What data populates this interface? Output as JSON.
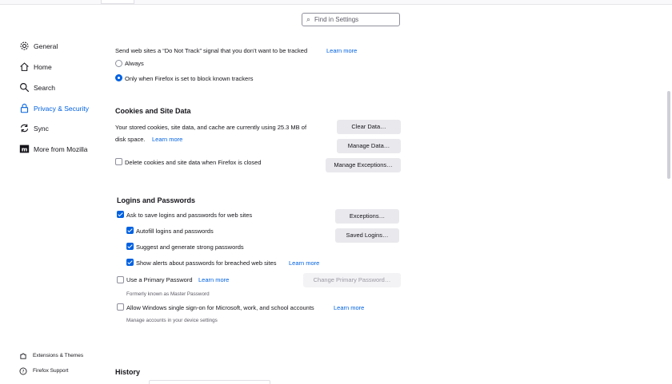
{
  "search": {
    "placeholder": "Find in Settings"
  },
  "sidebar": {
    "items": [
      {
        "label": "General",
        "icon": "gear-icon"
      },
      {
        "label": "Home",
        "icon": "home-icon"
      },
      {
        "label": "Search",
        "icon": "search-icon"
      },
      {
        "label": "Privacy & Security",
        "icon": "lock-icon",
        "active": true
      },
      {
        "label": "Sync",
        "icon": "sync-icon"
      },
      {
        "label": "More from Mozilla",
        "icon": "mozilla-icon"
      }
    ],
    "footer": [
      {
        "label": "Extensions & Themes",
        "icon": "puzzle-icon"
      },
      {
        "label": "Firefox Support",
        "icon": "help-icon"
      }
    ]
  },
  "dnt": {
    "text": "Send web sites a “Do Not Track” signal that you don’t want to be tracked",
    "learn_more": "Learn more",
    "always": "Always",
    "only_when": "Only when Firefox is set to block known trackers"
  },
  "cookies": {
    "title": "Cookies and Site Data",
    "line1": "Your stored cookies, site data, and cache are currently using 25.3 MB of",
    "line2": "disk space.",
    "learn_more": "Learn more",
    "clear_data": "Clear Data…",
    "manage_data": "Manage Data…",
    "delete_on_close": "Delete cookies and site data when Firefox is closed",
    "manage_exceptions": "Manage Exceptions…"
  },
  "logins": {
    "title": "Logins and Passwords",
    "ask_to_save": "Ask to save logins and passwords for web sites",
    "exceptions": "Exceptions…",
    "autofill": "Autofill logins and passwords",
    "saved_logins": "Saved Logins…",
    "suggest": "Suggest and generate strong passwords",
    "breach_alerts": "Show alerts about passwords for breached web sites",
    "breach_learn_more": "Learn more",
    "primary_password": "Use a Primary Password",
    "primary_learn_more": "Learn more",
    "change_primary": "Change Primary Password…",
    "formerly": "Formerly known as Master Password",
    "windows_sso": "Allow Windows single sign-on for Microsoft, work, and school accounts",
    "sso_learn_more": "Learn more",
    "sso_hint": "Manage accounts in your device settings"
  },
  "history": {
    "title": "History"
  },
  "colors": {
    "accent": "#0061e0",
    "button": "#e9e9ed"
  }
}
